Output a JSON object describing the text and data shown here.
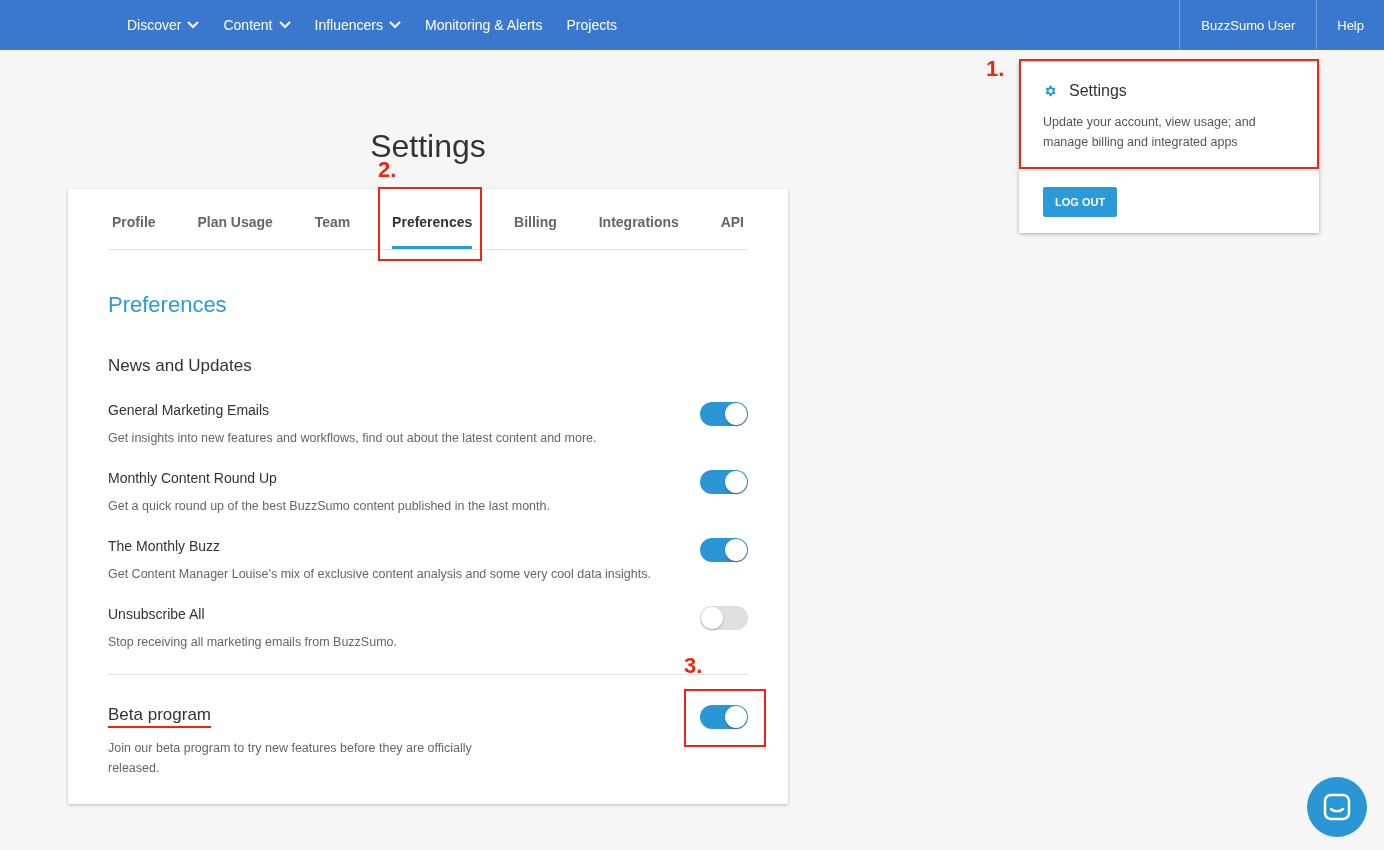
{
  "nav": {
    "items": [
      {
        "label": "Discover",
        "dropdown": true
      },
      {
        "label": "Content",
        "dropdown": true
      },
      {
        "label": "Influencers",
        "dropdown": true
      },
      {
        "label": "Monitoring & Alerts",
        "dropdown": false
      },
      {
        "label": "Projects",
        "dropdown": false
      }
    ],
    "user": "BuzzSumo User",
    "help": "Help"
  },
  "user_menu": {
    "title": "Settings",
    "description": "Update your account, view usage; and manage billing and integrated apps",
    "annotation": "1.",
    "button": "LOG OUT"
  },
  "page_title": "Settings",
  "tabs": [
    {
      "label": "Profile",
      "selected": false
    },
    {
      "label": "Plan Usage",
      "selected": false
    },
    {
      "label": "Team",
      "selected": false
    },
    {
      "label": "Preferences",
      "selected": true,
      "annotation": "2."
    },
    {
      "label": "Billing",
      "selected": false
    },
    {
      "label": "Integrations",
      "selected": false
    },
    {
      "label": "API",
      "selected": false
    }
  ],
  "section_title": "Preferences",
  "group_title": "News and Updates",
  "preferences": [
    {
      "title": "General Marketing Emails",
      "description": "Get insights into new features and workflows, find out about the latest content and more.",
      "on": true
    },
    {
      "title": "Monthly Content Round Up",
      "description": "Get a quick round up of the best BuzzSumo content published in the last month.",
      "on": true
    },
    {
      "title": "The Monthly Buzz",
      "description": "Get Content Manager Louise's mix of exclusive content analysis and some very cool data insights.",
      "on": true
    },
    {
      "title": "Unsubscribe All",
      "description": "Stop receiving all marketing emails from BuzzSumo.",
      "on": false
    }
  ],
  "beta": {
    "title": "Beta program",
    "underlined": true,
    "description": "Join our beta program to try new features before they are officially released.",
    "on": true,
    "annotation": "3."
  }
}
